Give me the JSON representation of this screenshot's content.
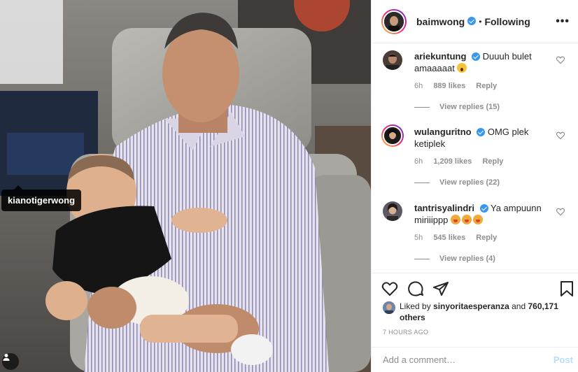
{
  "post_author": {
    "username": "baimwong",
    "follow_state": "Following",
    "more_icon": "more-horizontal-icon"
  },
  "photo": {
    "tag_username": "kianotigerwong",
    "user_tag_icon": "person-icon"
  },
  "comments": [
    {
      "username": "ariekuntung",
      "text": "Duuuh bulet amaaaaat",
      "emoji": "😱",
      "time": "6h",
      "likes": "889 likes",
      "reply_label": "Reply",
      "view_replies": "View replies (15)",
      "story_ring": false
    },
    {
      "username": "wulanguritno",
      "text": "OMG plek ketiplek",
      "emoji": "",
      "time": "6h",
      "likes": "1,209 likes",
      "reply_label": "Reply",
      "view_replies": "View replies (22)",
      "story_ring": true
    },
    {
      "username": "tantrisyalindri",
      "text": "Ya ampuunn miriiippp",
      "emoji": "🥵🥵🥵",
      "time": "5h",
      "likes": "545 likes",
      "reply_label": "Reply",
      "view_replies": "View replies (4)",
      "story_ring": false
    }
  ],
  "actions": {
    "like_icon": "heart-icon",
    "comment_icon": "comment-icon",
    "share_icon": "paper-plane-icon",
    "save_icon": "bookmark-icon"
  },
  "likes_summary": {
    "prefix": "Liked by",
    "username": "sinyoritaesperanza",
    "connector": "and",
    "others": "760,171 others"
  },
  "timestamp": "7 HOURS AGO",
  "comment_box": {
    "placeholder": "Add a comment…",
    "post_label": "Post"
  },
  "colors": {
    "verified": "#3897f0",
    "post_button": "#b2dffc",
    "muted_text": "#8e8e8e",
    "border": "#efefef"
  }
}
